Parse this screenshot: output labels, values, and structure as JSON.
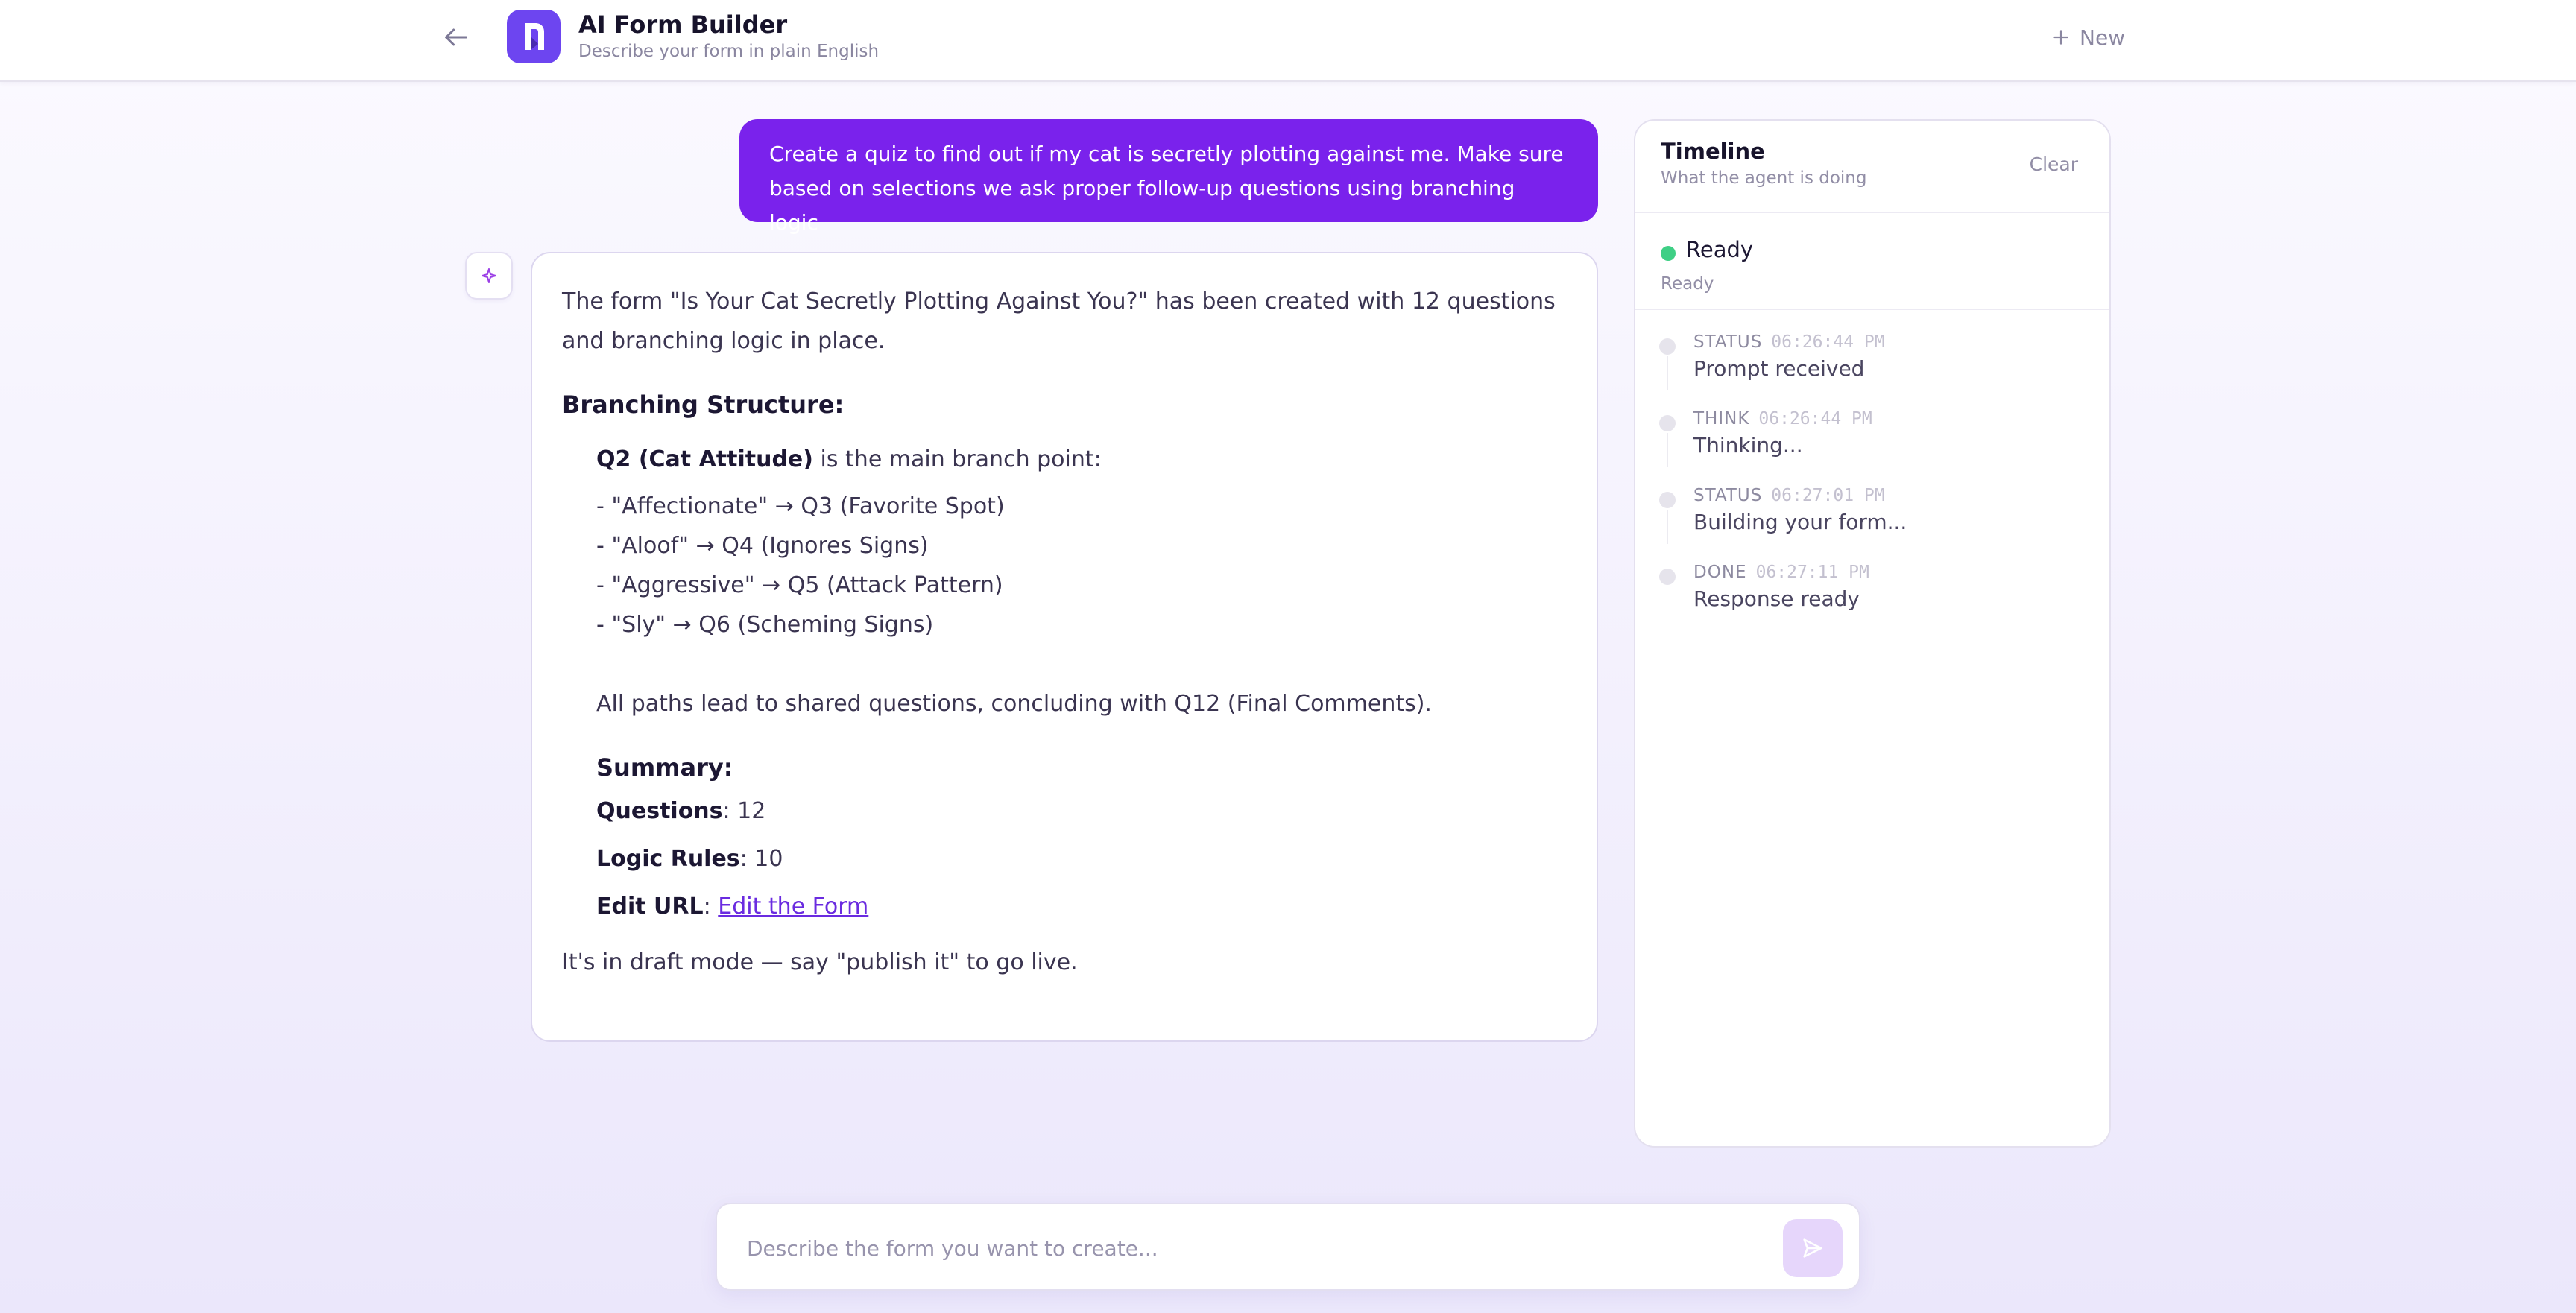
{
  "header": {
    "back_icon": "arrow-left-icon",
    "logo_icon": "app-logo",
    "title": "AI Form Builder",
    "subtitle": "Describe your form in plain English",
    "new_label": "New",
    "new_icon": "plus-icon"
  },
  "colors": {
    "accent": "#6d45f0",
    "user_bubble": "#7a22ec",
    "link": "#6a2be0",
    "status_ready": "#3ecf85"
  },
  "chat": {
    "user_message": "Create a quiz to find out if my cat is secretly plotting against me. Make sure based on selections we ask proper follow-up questions using branching logic",
    "assistant": {
      "avatar_icon": "sparkle-icon",
      "intro": "The form \"Is Your Cat Secretly Plotting Against You?\" has been created with 12 questions and branching logic in place.",
      "branching_heading": "Branching Structure:",
      "branch_point_bold": "Q2 (Cat Attitude)",
      "branch_point_rest": " is the main branch point:",
      "branches": [
        "- \"Affectionate\" → Q3 (Favorite Spot)",
        "- \"Aloof\" → Q4 (Ignores Signs)",
        "- \"Aggressive\" → Q5 (Attack Pattern)",
        "- \"Sly\" → Q6 (Scheming Signs)"
      ],
      "paths_note": "All paths lead to shared questions, concluding with Q12 (Final Comments).",
      "summary_heading": "Summary:",
      "questions_label": "Questions",
      "questions_value": ": 12",
      "logic_label": "Logic Rules",
      "logic_value": ": 10",
      "edit_label": "Edit URL",
      "edit_sep": ": ",
      "edit_link": "Edit the Form",
      "draft_note": "It's in draft mode — say \"publish it\" to go live."
    }
  },
  "timeline": {
    "title": "Timeline",
    "subtitle": "What the agent is doing",
    "clear_label": "Clear",
    "status_label": "Ready",
    "status_sub": "Ready",
    "events": [
      {
        "kind": "STATUS",
        "time": "06:26:44 PM",
        "text": "Prompt received"
      },
      {
        "kind": "THINK",
        "time": "06:26:44 PM",
        "text": "Thinking..."
      },
      {
        "kind": "STATUS",
        "time": "06:27:01 PM",
        "text": "Building your form..."
      },
      {
        "kind": "DONE",
        "time": "06:27:11 PM",
        "text": "Response ready"
      }
    ]
  },
  "composer": {
    "placeholder": "Describe the form you want to create...",
    "send_icon": "send-icon"
  }
}
